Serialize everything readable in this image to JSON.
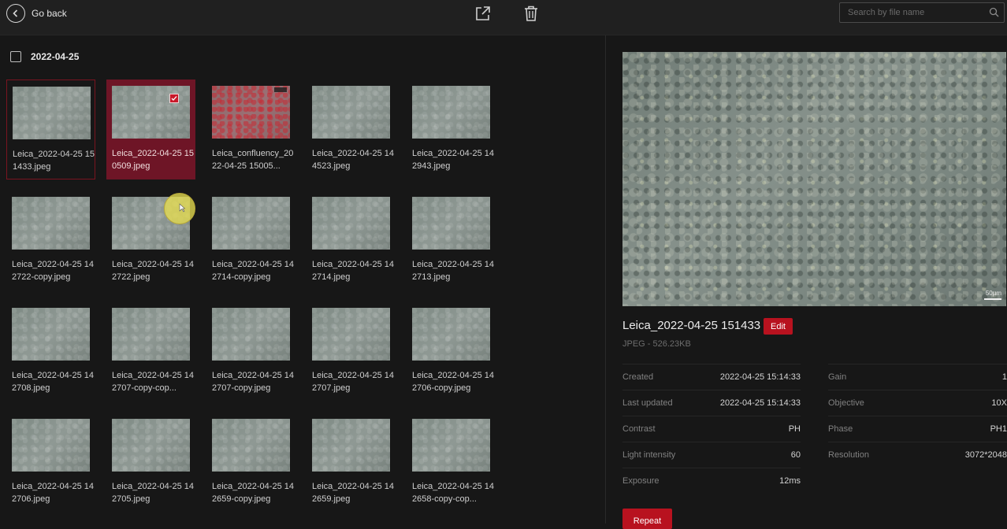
{
  "topbar": {
    "back_label": "Go back",
    "share_icon": "export-icon",
    "delete_icon": "trash-icon",
    "search_placeholder": "Search by file name"
  },
  "gallery": {
    "date_label": "2022-04-25",
    "tiles": [
      {
        "name": "Leica_2022-04-25 151433.jpeg",
        "state": "active"
      },
      {
        "name": "Leica_2022-04-25 150509.jpeg",
        "state": "checked"
      },
      {
        "name": "Leica_confluency_2022-04-25 15005...",
        "state": "normal",
        "variant": "red"
      },
      {
        "name": "Leica_2022-04-25 144523.jpeg",
        "state": "normal"
      },
      {
        "name": "Leica_2022-04-25 142943.jpeg",
        "state": "normal"
      },
      {
        "name": "Leica_2022-04-25 142722-copy.jpeg",
        "state": "normal"
      },
      {
        "name": "Leica_2022-04-25 142722.jpeg",
        "state": "normal"
      },
      {
        "name": "Leica_2022-04-25 142714-copy.jpeg",
        "state": "normal"
      },
      {
        "name": "Leica_2022-04-25 142714.jpeg",
        "state": "normal"
      },
      {
        "name": "Leica_2022-04-25 142713.jpeg",
        "state": "normal"
      },
      {
        "name": "Leica_2022-04-25 142708.jpeg",
        "state": "normal"
      },
      {
        "name": "Leica_2022-04-25 142707-copy-cop...",
        "state": "normal"
      },
      {
        "name": "Leica_2022-04-25 142707-copy.jpeg",
        "state": "normal"
      },
      {
        "name": "Leica_2022-04-25 142707.jpeg",
        "state": "normal"
      },
      {
        "name": "Leica_2022-04-25 142706-copy.jpeg",
        "state": "normal"
      },
      {
        "name": "Leica_2022-04-25 142706.jpeg",
        "state": "normal"
      },
      {
        "name": "Leica_2022-04-25 142705.jpeg",
        "state": "normal"
      },
      {
        "name": "Leica_2022-04-25 142659-copy.jpeg",
        "state": "normal"
      },
      {
        "name": "Leica_2022-04-25 142659.jpeg",
        "state": "normal"
      },
      {
        "name": "Leica_2022-04-25 142658-copy-cop...",
        "state": "normal"
      }
    ]
  },
  "detail": {
    "scale_label": "50µm",
    "title": "Leica_2022-04-25 151433",
    "edit_label": "Edit",
    "meta": "JPEG - 526.23KB",
    "left_props": [
      {
        "key": "Created",
        "value": "2022-04-25 15:14:33"
      },
      {
        "key": "Last updated",
        "value": "2022-04-25 15:14:33"
      },
      {
        "key": "Contrast",
        "value": "PH"
      },
      {
        "key": "Light intensity",
        "value": "60"
      },
      {
        "key": "Exposure",
        "value": "12ms"
      }
    ],
    "right_props": [
      {
        "key": "Gain",
        "value": "1"
      },
      {
        "key": "Objective",
        "value": "10X"
      },
      {
        "key": "Phase",
        "value": "PH1"
      },
      {
        "key": "Resolution",
        "value": "3072*2048"
      }
    ],
    "repeat_label": "Repeat"
  },
  "colors": {
    "accent": "#b8121f",
    "selected_tile": "#6e1526",
    "background": "#171717"
  }
}
